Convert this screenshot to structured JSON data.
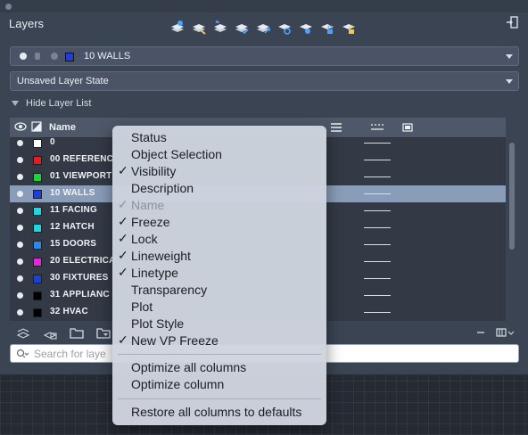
{
  "panel": {
    "title": "Layers"
  },
  "toolbar": {
    "icons": [
      "new-layer-icon",
      "new-layer-vp-frozen-icon",
      "delete-layer-icon",
      "set-current-icon",
      "match-icon",
      "layer-settings-icon",
      "layer-properties-icon",
      "lock-unlock-icon",
      "isolate-icon"
    ]
  },
  "current_layer": {
    "name": "10 WALLS",
    "color": "#1f3fd6"
  },
  "layer_state": {
    "value": "Unsaved Layer State"
  },
  "hide_layer_list": {
    "label": "Hide Layer List"
  },
  "grid": {
    "header": {
      "name_label": "Name"
    },
    "rows": [
      {
        "name": "0",
        "color": "#ffffff",
        "selected": false
      },
      {
        "name": "00 REFERENC",
        "color": "#e02020",
        "selected": false
      },
      {
        "name": "01 VIEWPORT",
        "color": "#1fd23a",
        "selected": false
      },
      {
        "name": "10 WALLS",
        "color": "#1f3fd6",
        "selected": true
      },
      {
        "name": "11 FACING",
        "color": "#22d6e0",
        "selected": false
      },
      {
        "name": "12 HATCH",
        "color": "#22d6e0",
        "selected": false
      },
      {
        "name": "15 DOORS",
        "color": "#2a8ae8",
        "selected": false
      },
      {
        "name": "20 ELECTRICA",
        "color": "#e02ad6",
        "selected": false
      },
      {
        "name": "30 FIXTURES",
        "color": "#1f3fd6",
        "selected": false
      },
      {
        "name": "31 APPLIANC",
        "color": "#000000",
        "selected": false
      },
      {
        "name": "32 HVAC",
        "color": "#000000",
        "selected": false
      }
    ]
  },
  "search": {
    "placeholder": "Search for laye"
  },
  "context_menu": {
    "items": [
      {
        "label": "Status",
        "checked": false,
        "disabled": false
      },
      {
        "label": "Object Selection",
        "checked": false,
        "disabled": false
      },
      {
        "label": "Visibility",
        "checked": true,
        "disabled": false
      },
      {
        "label": "Description",
        "checked": false,
        "disabled": false
      },
      {
        "label": "Name",
        "checked": true,
        "disabled": true
      },
      {
        "label": "Freeze",
        "checked": true,
        "disabled": false
      },
      {
        "label": "Lock",
        "checked": true,
        "disabled": false
      },
      {
        "label": "Lineweight",
        "checked": true,
        "disabled": false
      },
      {
        "label": "Linetype",
        "checked": true,
        "disabled": false
      },
      {
        "label": "Transparency",
        "checked": false,
        "disabled": false
      },
      {
        "label": "Plot",
        "checked": false,
        "disabled": false
      },
      {
        "label": "Plot Style",
        "checked": false,
        "disabled": false
      },
      {
        "label": "New VP Freeze",
        "checked": true,
        "disabled": false
      }
    ],
    "optimize_all": "Optimize all columns",
    "optimize_one": "Optimize column",
    "restore": "Restore all columns to defaults",
    "check_glyph": "✓"
  }
}
